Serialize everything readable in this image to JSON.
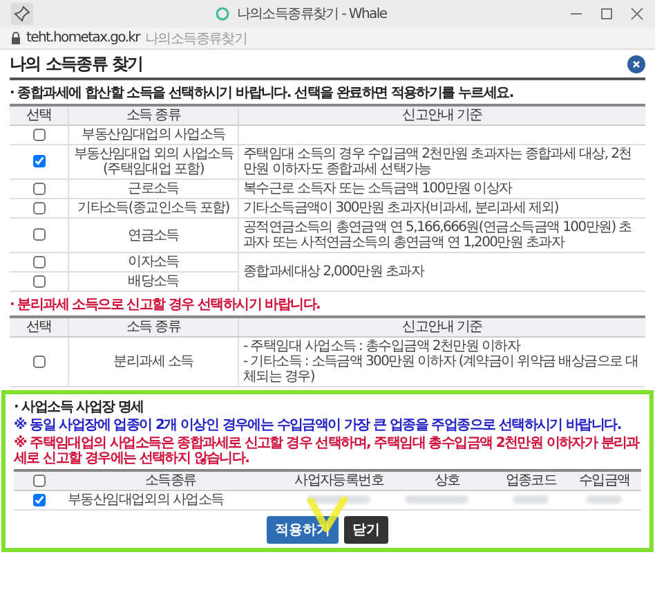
{
  "window": {
    "title": "나의소득종류찾기 - Whale"
  },
  "address": {
    "domain": "teht.hometax.go.kr",
    "page": "나의소득종류찾기"
  },
  "dialog_title": "나의 소득종류 찾기",
  "combined": {
    "note": "· 종합과세에 합산할 소득을 선택하시기 바랍니다. 선택을 완료하면 적용하기를 누르세요.",
    "columns": [
      "선택",
      "소득 종류",
      "신고안내 기준"
    ],
    "groups": [
      {
        "items": [
          {
            "label": "부동산임대업의 사업소득",
            "checked": false
          }
        ]
      },
      {
        "criteria": "주택임대 소득의 경우 수입금액 2천만원 초과자는 종합과세 대상, 2천만원 이하자도 종합과세 선택가능",
        "items": [
          {
            "label": "부동산임대업 외의 사업소득 (주택임대업 포함)",
            "checked": true
          }
        ]
      },
      {
        "criteria": "복수근로 소득자 또는 소득금액 100만원 이상자",
        "items": [
          {
            "label": "근로소득",
            "checked": false
          }
        ]
      },
      {
        "criteria": "기타소득금액이 300만원 초과자(비과세, 분리과세 제외)",
        "items": [
          {
            "label": "기타소득(종교인소득 포함)",
            "checked": false
          }
        ]
      },
      {
        "criteria": "공적연금소득의 총연금액 연 5,166,666원(연금소득금액 100만원) 초과자 또는 사적연금소득의 총연금액 연 1,200만원 초과자",
        "items": [
          {
            "label": "연금소득",
            "checked": false
          }
        ]
      },
      {
        "criteria": "종합과세대상 2,000만원 초과자",
        "items": [
          {
            "label": "이자소득",
            "checked": false
          },
          {
            "label": "배당소득",
            "checked": false
          }
        ]
      }
    ]
  },
  "separate": {
    "note": "· 분리과세 소득으로 신고할 경우 선택하시기 바랍니다.",
    "columns": [
      "선택",
      "소득 종류",
      "신고안내 기준"
    ],
    "rows": [
      {
        "label": "분리과세 소득",
        "checked": false,
        "criteria": [
          "- 주택임대 사업소득 : 총수입금액 2천만원 이하자",
          "- 기타소득 : 소득금액 300만원 이하자 (계약금이 위약금 배상금으로 대체되는 경우)"
        ]
      }
    ]
  },
  "business": {
    "title": "· 사업소득 사업장 명세",
    "notes": [
      {
        "kind": "blue",
        "text": "※ 동일 사업장에 업종이 2개 이상인 경우에는 수입금액이 가장 큰 업종을 주업종으로 선택하시기 바랍니다."
      },
      {
        "kind": "red",
        "text": "※ 주택임대업의 사업소득은 종합과세로 신고할 경우 선택하며, 주택임대 총수입금액 2천만원 이하자가 분리과세로 신고할 경우에는 선택하지 않습니다."
      }
    ],
    "all_checked": false,
    "columns": [
      "소득종류",
      "사업자등록번호",
      "상호",
      "업종코드",
      "수입금액"
    ],
    "rows": [
      {
        "checked": true,
        "label": "부동산임대업외의 사업소득"
      }
    ]
  },
  "buttons": [
    {
      "kind": "primary",
      "label": "적용하기"
    },
    {
      "kind": "dark",
      "label": "닫기"
    }
  ]
}
